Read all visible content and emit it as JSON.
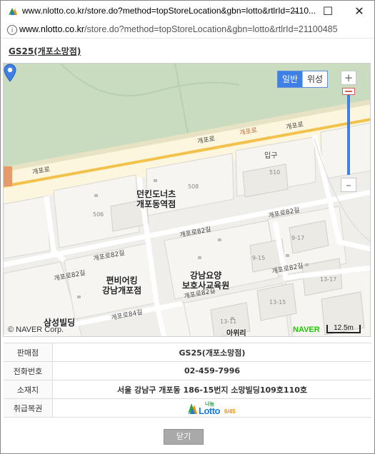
{
  "window": {
    "title": "www.nlotto.co.kr/store.do?method=topStoreLocation&gbn=lotto&rtlrId=2110...",
    "minimize_glyph": "–",
    "maximize_glyph": "☐",
    "close_glyph": "✕"
  },
  "address": {
    "info_glyph": "i",
    "host": "www.nlotto.co.kr",
    "path": "/store.do?method=topStoreLocation&gbn=lotto&rtlrId=21100485"
  },
  "store": {
    "title": "GS25(개포소망점)"
  },
  "map": {
    "type_normal": "일반",
    "type_satellite": "위성",
    "zoom_in": "+",
    "zoom_out": "–",
    "copyright": "© NAVER Corp.",
    "brand": "NAVER",
    "scale": "12.5m",
    "labels": {
      "dunkin": "던킨도너츠\n개포동역점",
      "convenience": "편비어킹\n강남개포점",
      "gangnam": "강남요양\n보호사교육원",
      "samsung": "삼성빌딩",
      "entrance": "입구",
      "road_gaepo1": "개포로",
      "road_gaepo2": "개포로",
      "road_gaepo3": "개포로",
      "road_82_1": "개포로82길",
      "road_82_2": "개포로82길",
      "road_82_3": "개포로82길",
      "road_82_4": "개포로82길",
      "road_82_5": "개포로82길",
      "road_82_6": "개포로82길",
      "road_84": "개포로84길",
      "road_red": "개포로",
      "num_510": "510",
      "num_506": "506",
      "num_508": "508",
      "num_917": "9-17",
      "num_915": "9-15",
      "num_1317": "13-17",
      "num_1315": "13-15",
      "num_1311": "13-11",
      "partial_bottom": "아위리"
    }
  },
  "info": {
    "rows": [
      {
        "label": "판매점",
        "value": "GS25(개포소망점)"
      },
      {
        "label": "전화번호",
        "value": "02-459-7996"
      },
      {
        "label": "소재지",
        "value": "서울 강남구 개포동 186-15번지 소망빌딩109호110호"
      },
      {
        "label": "취급복권",
        "value": ""
      }
    ],
    "logo_small": "나눔",
    "logo_main": "Lotto",
    "logo_num": "6/45"
  },
  "buttons": {
    "close": "닫기"
  },
  "colors": {
    "accent": "#3f80e6",
    "road_main": "#f2c24d",
    "green_area": "#c9dcc0",
    "naver_green": "#1ec800"
  }
}
